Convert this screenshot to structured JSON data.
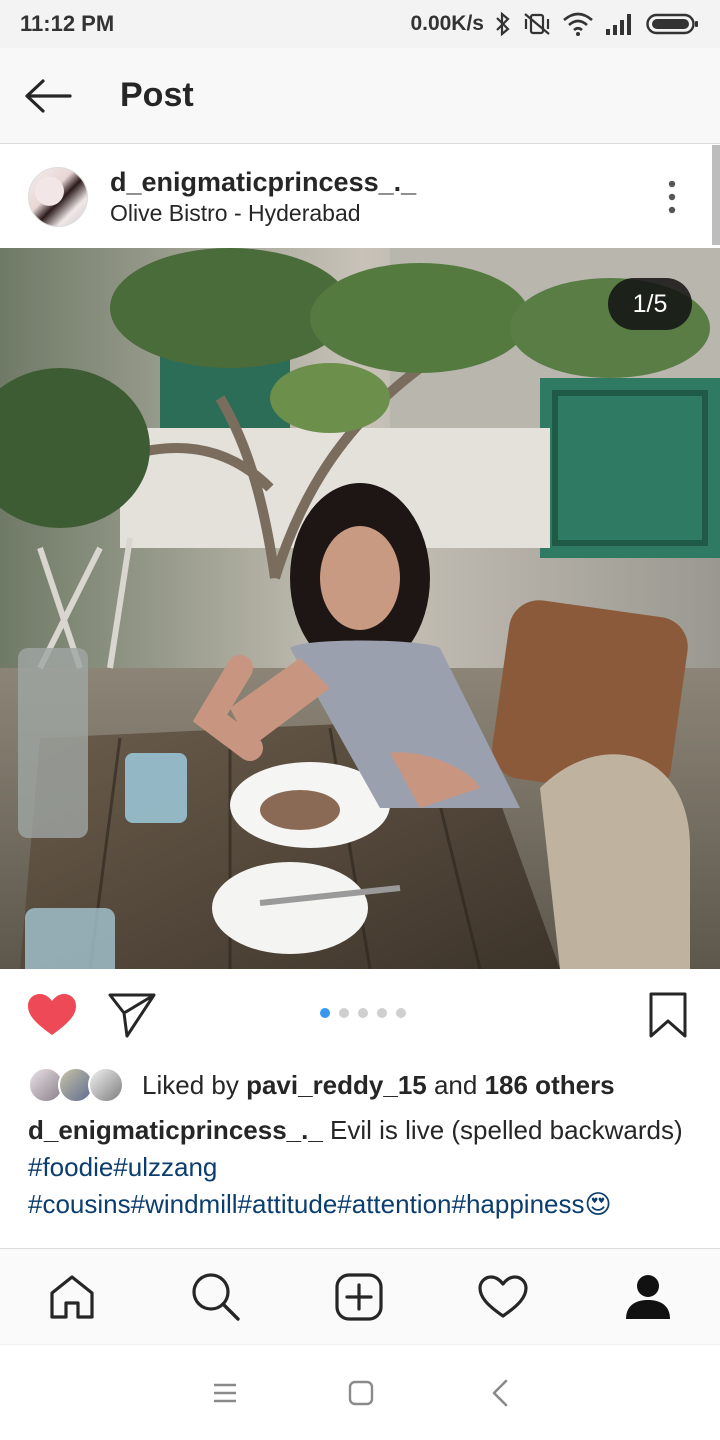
{
  "status_bar": {
    "time": "11:12 PM",
    "net_speed": "0.00K/s",
    "icons": [
      "bluetooth-icon",
      "vibrate-off-icon",
      "wifi-icon",
      "signal-icon",
      "battery-icon"
    ]
  },
  "app_bar": {
    "title": "Post",
    "back_icon": "arrow-left-icon"
  },
  "post": {
    "username": "d_enigmaticprincess_._",
    "location": "Olive Bistro - Hyderabad",
    "media_counter": "1/5",
    "media_count": 5,
    "media_index": 1,
    "liked": true,
    "likes": {
      "prefix": "Liked by ",
      "user": "pavi_reddy_15",
      "middle": " and ",
      "others": "186 others"
    },
    "caption": {
      "username": "d_enigmaticprincess_._",
      "text": " Evil is live (spelled backwards)",
      "hashtags_line1": " #foodie#ulzzang",
      "hashtags_line2": "#cousins#windmill#attitude#attention#happiness😍"
    }
  },
  "colors": {
    "like_red": "#ed4956",
    "dot_active": "#3897f0",
    "hashtag": "#0b3d6e"
  },
  "bottom_nav": {
    "items": [
      "home-icon",
      "search-icon",
      "add-post-icon",
      "activity-heart-icon",
      "profile-icon"
    ]
  },
  "system_nav": {
    "items": [
      "menu-icon",
      "home-square-icon",
      "back-chevron-icon"
    ]
  }
}
